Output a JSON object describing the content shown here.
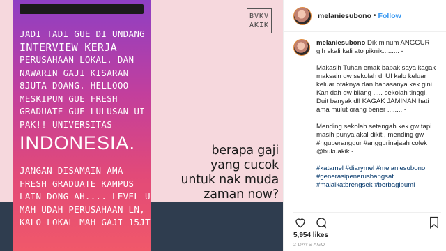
{
  "image": {
    "story_lines": [
      "JADI TADI GUE DI UNDANG",
      "INTERVIEW KERJA",
      "PERUSAHAAN LOKAL. DAN",
      "NAWARIN GAJI KISARAN",
      "8JUTA DOANG. HELLOOO",
      "MESKIPUN GUE FRESH",
      "GRADUATE GUE LULUSAN UI",
      "PAK!! UNIVERSITAS"
    ],
    "story_big": "INDONESIA.",
    "story_lines_2": [
      "JANGAN DISAMAIN AMA",
      "FRESH GRADUATE KAMPUS",
      "LAIN DONG AH.... LEVEL UI",
      "MAH UDAH PERUSAHAAN LN,",
      "KALO LOKAL MAH GAJI 15JT"
    ],
    "brand_logo_text": "BVKV AKIK",
    "headline_lines": [
      "berapa gaji",
      "yang cucok",
      "untuk nak muda",
      "zaman now?"
    ],
    "colors": {
      "gradient_top": "#8e3fc4",
      "gradient_bottom": "#f0586a",
      "background": "#f6d8dd",
      "footer": "#2f3d4f"
    }
  },
  "header": {
    "username": "melaniesubono",
    "separator": "•",
    "follow_label": "Follow"
  },
  "caption": {
    "username": "melaniesubono",
    "paragraphs": [
      "Dik minum ANGGUR gih skali kali ato piknik......... -",
      "Makasih Tuhan emak bapak saya kagak maksain gw sekolah di UI kalo keluar keluar otaknya dan bahasanya kek gini",
      "Kan dah gw bilang ..... sekolah tinggi. Duit banyak dll KAGAK JAMINAN hati ama mulut orang bener ........ -",
      "Mending sekolah setengah kek gw tapi masih punya akal dikit , mending gw #nguberanggur #anggurinajaah colek @bukuakik -",
      "#katamel #diarymel #melaniesubono #generasipenerusbangsat #malaikatbrengsek #berbagibumi"
    ]
  },
  "actions": {
    "icons": [
      "heart-icon",
      "comment-icon",
      "share-icon",
      "bookmark-icon"
    ]
  },
  "likes": "5,954 likes",
  "timestamp": "2 DAYS AGO"
}
